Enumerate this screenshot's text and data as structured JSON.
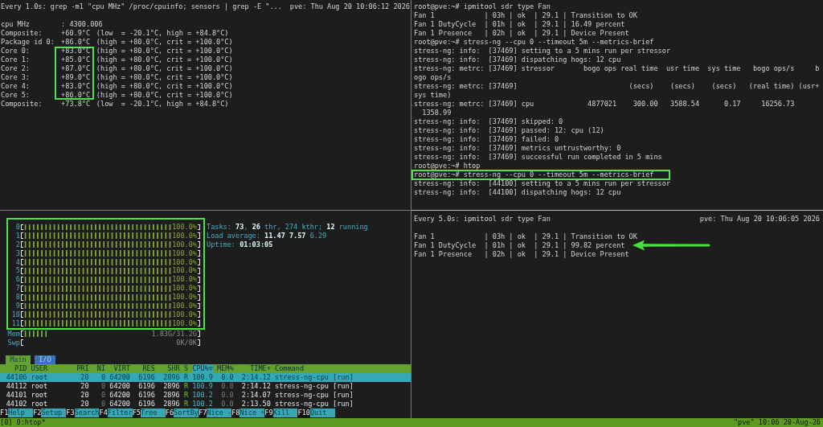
{
  "sensors_pane": {
    "header": {
      "command": "Every 1.0s: grep -m1 \"cpu MHz\" /proc/cpuinfo; sensors | grep -E \"...",
      "host_time": "pve: Thu Aug 20 10:06:12 2026"
    },
    "rows": [
      {
        "label": "cpu MHz",
        "reading": ": 4300.006",
        "highlighted": false
      },
      {
        "label": "Composite:",
        "reading": "+60.9°C",
        "limits": "(low  = -20.1°C, high = +84.8°C)",
        "highlighted": false
      },
      {
        "label": "Package id 0:",
        "reading": "+86.0°C",
        "limits": "(high = +80.0°C, crit = +100.0°C)",
        "highlighted": false
      },
      {
        "label": "Core 0:",
        "reading": "+83.0°C",
        "limits": "(high = +80.0°C, crit = +100.0°C)",
        "highlighted": true
      },
      {
        "label": "Core 1:",
        "reading": "+85.0°C",
        "limits": "(high = +80.0°C, crit = +100.0°C)",
        "highlighted": true
      },
      {
        "label": "Core 2:",
        "reading": "+87.0°C",
        "limits": "(high = +80.0°C, crit = +100.0°C)",
        "highlighted": true
      },
      {
        "label": "Core 3:",
        "reading": "+89.0°C",
        "limits": "(high = +80.0°C, crit = +100.0°C)",
        "highlighted": true
      },
      {
        "label": "Core 4:",
        "reading": "+83.0°C",
        "limits": "(high = +80.0°C, crit = +100.0°C)",
        "highlighted": true
      },
      {
        "label": "Core 5:",
        "reading": "+86.0°C",
        "limits": "(high = +80.0°C, crit = +100.0°C)",
        "highlighted": true
      },
      {
        "label": "Composite:",
        "reading": "+73.8°C",
        "limits": "(low  = -20.1°C, high = +84.8°C)",
        "highlighted": false
      }
    ]
  },
  "shell_pane": {
    "lines": [
      {
        "text": "root@pve:~# ipmitool sdr type Fan",
        "highlighted": false
      },
      {
        "text": "Fan 1            | 03h | ok  | 29.1 | Transition to OK",
        "highlighted": false
      },
      {
        "text": "Fan 1 DutyCycle  | 01h | ok  | 29.1 | 16.49 percent",
        "highlighted": false
      },
      {
        "text": "Fan 1 Presence   | 02h | ok  | 29.1 | Device Present",
        "highlighted": false
      },
      {
        "text": "root@pve:~# stress-ng --cpu 0 --timeout 5m --metrics-brief",
        "highlighted": false
      },
      {
        "text": "stress-ng: info:  [37469] setting to a 5 mins run per stressor",
        "highlighted": false
      },
      {
        "text": "stress-ng: info:  [37469] dispatching hogs: 12 cpu",
        "highlighted": false
      },
      {
        "text": "stress-ng: metrc: [37469] stressor       bogo ops real time  usr time  sys time   bogo ops/s     b",
        "highlighted": false
      },
      {
        "text": "ogo ops/s",
        "highlighted": false
      },
      {
        "text": "stress-ng: metrc: [37469]                           (secs)    (secs)    (secs)   (real time) (usr+",
        "highlighted": false
      },
      {
        "text": "sys time)",
        "highlighted": false
      },
      {
        "text": "stress-ng: metrc: [37469] cpu             4877021    300.00   3588.54      0.17     16256.73",
        "highlighted": false
      },
      {
        "text": "  1358.99",
        "highlighted": false
      },
      {
        "text": "stress-ng: info:  [37469] skipped: 0",
        "highlighted": false
      },
      {
        "text": "stress-ng: info:  [37469] passed: 12: cpu (12)",
        "highlighted": false
      },
      {
        "text": "stress-ng: info:  [37469] failed: 0",
        "highlighted": false
      },
      {
        "text": "stress-ng: info:  [37469] metrics untrustworthy: 0",
        "highlighted": false
      },
      {
        "text": "stress-ng: info:  [37469] successful run completed in 5 mins",
        "highlighted": false
      },
      {
        "text": "root@pve:~# htop",
        "highlighted": false
      },
      {
        "text": "root@pve:~# stress-ng --cpu 0 --timeout 5m --metrics-brief",
        "highlighted": true
      },
      {
        "text": "stress-ng: info:  [44100] setting to a 5 mins run per stressor",
        "highlighted": false
      },
      {
        "text": "stress-ng: info:  [44100] dispatching hogs: 12 cpu",
        "highlighted": false
      }
    ]
  },
  "htop_pane": {
    "cpu_meters": {
      "highlighted": true,
      "items": [
        {
          "label": "0",
          "level": 1,
          "reading": "100.0%"
        },
        {
          "label": "1",
          "level": 1,
          "reading": "100.0%"
        },
        {
          "label": "2",
          "level": 1,
          "reading": "100.0%"
        },
        {
          "label": "3",
          "level": 1,
          "reading": "100.0%"
        },
        {
          "label": "4",
          "level": 1,
          "reading": "100.0%"
        },
        {
          "label": "5",
          "level": 1,
          "reading": "100.0%"
        },
        {
          "label": "6",
          "level": 1,
          "reading": "100.0%"
        },
        {
          "label": "7",
          "level": 1,
          "reading": "100.0%"
        },
        {
          "label": "8",
          "level": 1,
          "reading": "100.0%"
        },
        {
          "label": "9",
          "level": 1,
          "reading": "100.0%"
        },
        {
          "label": "10",
          "level": 1,
          "reading": "100.0%"
        },
        {
          "label": "11",
          "level": 1,
          "reading": "100.0%"
        }
      ]
    },
    "summary": [
      "Tasks: **73**, **26** thr, 274 kthr; **12** running",
      "Load average: **11.47** **7.57** 6.29",
      "Uptime: **01:03:05**"
    ],
    "memory_meters": [
      {
        "label": "Mem",
        "level": 0.2,
        "reading": "1.83G/31.2G"
      },
      {
        "label": "Swp",
        "reading": "0K/0K"
      }
    ],
    "tabs": [
      {
        "label": "Main",
        "selected": true
      },
      {
        "label": "I/O",
        "selected": false
      }
    ],
    "columns": [
      {
        "label": "PID",
        "sorted": false
      },
      {
        "label": "USER",
        "sorted": false
      },
      {
        "label": "PRI",
        "sorted": false
      },
      {
        "label": "NI",
        "sorted": false
      },
      {
        "label": "VIRT",
        "sorted": false
      },
      {
        "label": "RES",
        "sorted": false
      },
      {
        "label": "SHR",
        "sorted": false
      },
      {
        "label": "S",
        "sorted": false
      },
      {
        "label": "CPU%▽",
        "sorted": true
      },
      {
        "label": "MEM%",
        "sorted": false
      },
      {
        "label": "TIME+",
        "sorted": false
      },
      {
        "label": "Command",
        "sorted": false
      }
    ],
    "processes": [
      {
        "selected": true,
        "cells": [
          "44106",
          "root",
          "20",
          "0",
          "64200",
          "6196",
          "2896",
          "R",
          "100.9",
          "0.0",
          "2:14.12",
          "stress-ng-cpu [run]"
        ]
      },
      {
        "selected": false,
        "cells": [
          "44112",
          "root",
          "20",
          "0",
          "64200",
          "6196",
          "2896",
          "R",
          "100.9",
          "0.0",
          "2:14.12",
          "stress-ng-cpu [run]"
        ]
      },
      {
        "selected": false,
        "cells": [
          "44101",
          "root",
          "20",
          "0",
          "64200",
          "6196",
          "2896",
          "R",
          "100.2",
          "0.0",
          "2:14.07",
          "stress-ng-cpu [run]"
        ]
      },
      {
        "selected": false,
        "cells": [
          "44102",
          "root",
          "20",
          "0",
          "64200",
          "6196",
          "2896",
          "R",
          "100.2",
          "0.0",
          "2:13.50",
          "stress-ng-cpu [run]"
        ]
      }
    ],
    "function_keys": [
      {
        "key": "F1",
        "label": "Help"
      },
      {
        "key": "F2",
        "label": "Setup"
      },
      {
        "key": "F3",
        "label": "Search"
      },
      {
        "key": "F4",
        "label": "Filter"
      },
      {
        "key": "F5",
        "label": "Tree"
      },
      {
        "key": "F6",
        "label": "SortBy"
      },
      {
        "key": "F7",
        "label": "Nice -"
      },
      {
        "key": "F8",
        "label": "Nice +"
      },
      {
        "key": "F9",
        "label": "Kill"
      },
      {
        "key": "F10",
        "label": "Quit"
      }
    ]
  },
  "watch_pane": {
    "header": {
      "command": "Every 5.0s: ipmitool sdr type Fan",
      "host_time": "pve: Thu Aug 20 10:06:05 2026"
    },
    "rows": [
      {
        "text": "Fan 1            | 03h | ok  | 29.1 | Transition to OK",
        "arrow": false
      },
      {
        "text": "Fan 1 DutyCycle  | 01h | ok  | 29.1 | 99.82 percent",
        "arrow": true
      },
      {
        "text": "Fan 1 Presence   | 02h | ok  | 29.1 | Device Present",
        "arrow": false
      }
    ]
  },
  "status_bar": {
    "window": "[0] 0:htop*",
    "host_clock": "\"pve\" 10:06 20-Aug-26"
  }
}
